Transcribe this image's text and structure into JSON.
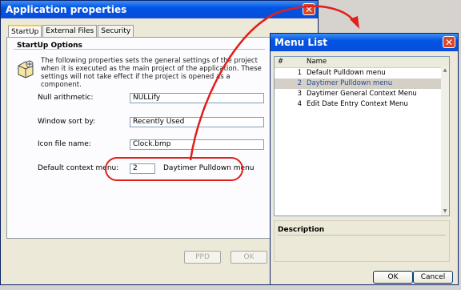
{
  "app_window": {
    "title": "Application properties",
    "tabs": [
      "StartUp",
      "External Files",
      "Security"
    ],
    "group_title": "StartUp Options",
    "description": "The following properties sets the general settings of the project when it is executed as the main project of the application. These settings will not take effect if the project is opened as a component.",
    "fields": {
      "null_arithmetic": {
        "label": "Null arithmetic:",
        "value": "NULLify"
      },
      "window_sort_by": {
        "label": "Window sort by:",
        "value": "Recently Used"
      },
      "icon_file_name": {
        "label": "Icon file name:",
        "value": "Clock.bmp"
      },
      "default_context_menu": {
        "label": "Default context menu:",
        "value": "2",
        "menu_name": "Daytimer Pulldown menu"
      }
    },
    "buttons": {
      "ppd": "PPD",
      "ok": "OK"
    },
    "close_glyph": "✕"
  },
  "menu_list": {
    "title": "Menu List",
    "columns": [
      "#",
      "Name"
    ],
    "rows": [
      {
        "num": "1",
        "name": "Default Pulldown menu"
      },
      {
        "num": "2",
        "name": "Daytimer Pulldown menu",
        "selected": true
      },
      {
        "num": "3",
        "name": "Daytimer General Context Menu"
      },
      {
        "num": "4",
        "name": "Edit Date Entry Context Menu"
      }
    ],
    "description_label": "Description",
    "buttons": {
      "ok": "OK",
      "cancel": "Cancel"
    },
    "close_glyph": "✕"
  },
  "colors": {
    "highlight": "#e0201c",
    "titlebar": "#0054e3",
    "selected_row_text": "#2a4d8f"
  }
}
